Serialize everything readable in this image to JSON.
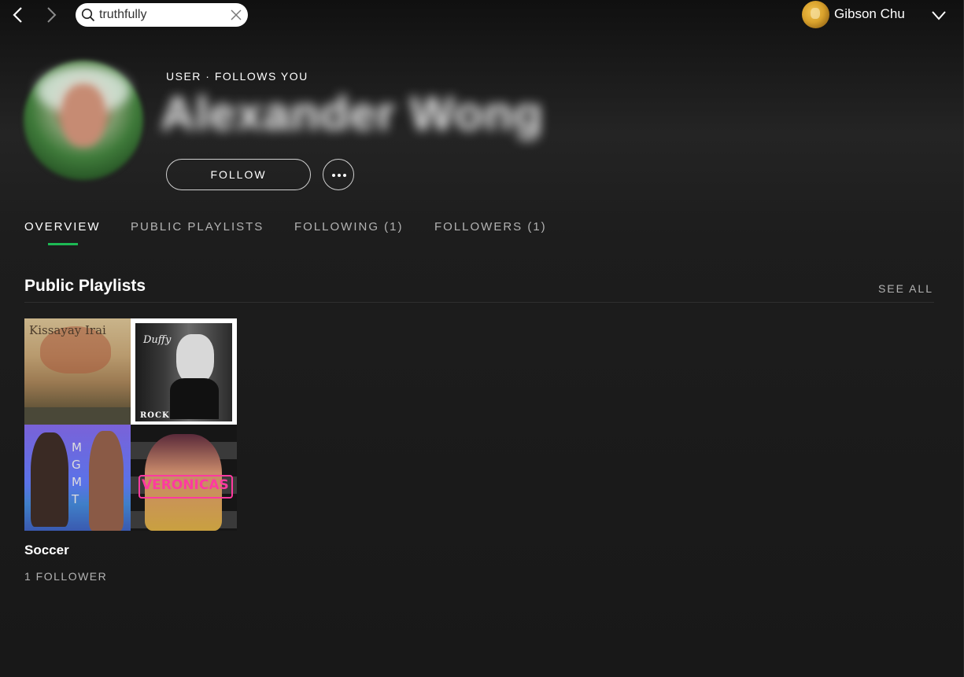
{
  "topbar": {
    "back_icon": "chevron-left-icon",
    "forward_icon": "chevron-right-icon",
    "search": {
      "value": "truthfully",
      "icon": "search-icon",
      "clear_icon": "close-icon"
    },
    "user": {
      "name": "Gibson Chu",
      "menu_icon": "chevron-down-icon"
    }
  },
  "profile": {
    "type_label": "USER · FOLLOWS YOU",
    "display_name": "Alexander Wong",
    "follow_label": "FOLLOW",
    "more_icon": "more-options-icon"
  },
  "tabs": [
    {
      "label": "OVERVIEW",
      "active": true
    },
    {
      "label": "PUBLIC PLAYLISTS",
      "active": false
    },
    {
      "label": "FOLLOWING (1)",
      "active": false
    },
    {
      "label": "FOLLOWERS (1)",
      "active": false
    }
  ],
  "section": {
    "title": "Public Playlists",
    "see_all": "SEE ALL"
  },
  "playlists": [
    {
      "name": "Soccer",
      "followers": "1 FOLLOWER",
      "cover_text": {
        "tile1": "Kissayay Irai",
        "tile2_top": "Duffy",
        "tile2_bottom": "ROCKFERRY",
        "tile3": "MGMT",
        "tile4": "VERONICAS"
      }
    }
  ],
  "colors": {
    "accent": "#1db954",
    "muted_text": "#b3b3b3",
    "background": "#181818"
  }
}
